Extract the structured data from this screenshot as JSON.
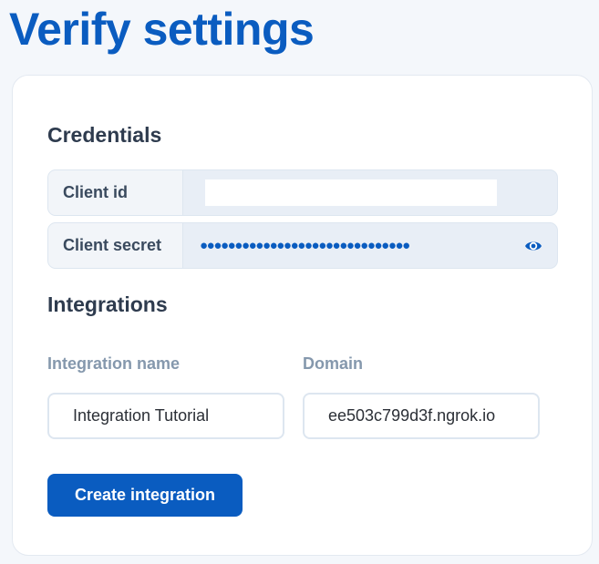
{
  "page": {
    "title": "Verify settings"
  },
  "credentials": {
    "title": "Credentials",
    "client_id_label": "Client id",
    "client_id_value": "",
    "client_secret_label": "Client secret",
    "client_secret_masked": "●●●●●●●●●●●●●●●●●●●●●●●●●●●●●●",
    "reveal_icon": "eye-icon"
  },
  "integrations": {
    "title": "Integrations",
    "name_label": "Integration name",
    "name_value": "Integration Tutorial",
    "domain_label": "Domain",
    "domain_value": "ee503c799d3f.ngrok.io",
    "create_label": "Create integration"
  },
  "colors": {
    "accent": "#0a5cc0",
    "heading": "#2e3b4e",
    "muted_label": "#8598ad",
    "row_bg": "#e8eef6"
  }
}
